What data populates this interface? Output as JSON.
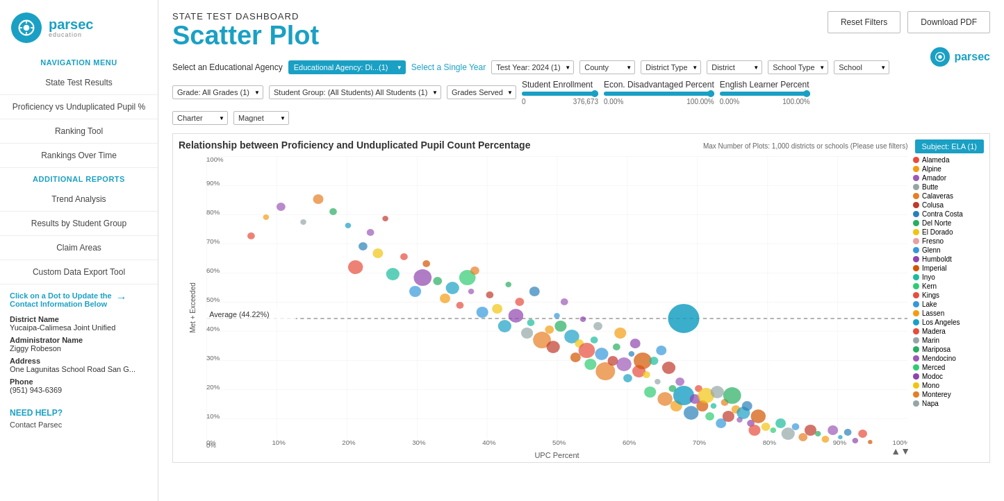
{
  "sidebar": {
    "logo_text": "parsec",
    "logo_sub": "education",
    "nav_title": "NAVIGATION MENU",
    "nav_items": [
      {
        "label": "State Test Results"
      },
      {
        "label": "Proficiency vs Unduplicated Pupil %"
      },
      {
        "label": "Ranking Tool"
      },
      {
        "label": "Rankings Over Time"
      }
    ],
    "additional_title": "ADDITIONAL REPORTS",
    "additional_items": [
      {
        "label": "Trend Analysis"
      },
      {
        "label": "Results by Student Group"
      },
      {
        "label": "Claim Areas"
      },
      {
        "label": "Custom Data Export Tool"
      }
    ],
    "click_hint_line1": "Click on a Dot to Update the",
    "click_hint_line2": "Contact Information Below",
    "district_name_label": "District Name",
    "district_name_value": "Yucaipa-Calimesa Joint Unified",
    "admin_name_label": "Administrator Name",
    "admin_name_value": "Ziggy Robeson",
    "address_label": "Address",
    "address_value": "One Lagunitas School Road San G...",
    "phone_label": "Phone",
    "phone_value": "(951) 943-6369",
    "need_help": "NEED HELP?",
    "contact_link": "Contact Parsec"
  },
  "header": {
    "page_label": "STATE TEST DASHBOARD",
    "page_title": "Scatter Plot",
    "reset_btn": "Reset Filters",
    "download_btn": "Download PDF"
  },
  "filters": {
    "agency_label": "Select an Educational Agency",
    "year_label": "Select a Single Year",
    "agency_value": "Educational Agency: Di...(1)",
    "year_value": "Test Year: 2024  (1)",
    "county_label": "County",
    "district_type_label": "District Type",
    "district_label": "District",
    "school_type_label": "School Type",
    "school_label": "School",
    "grade_label": "Grade: All Grades",
    "grade_count": "(1)",
    "student_group_label": "Student Group: (All Students) All Students",
    "student_group_count": "(1)",
    "grades_served_label": "Grades Served",
    "charter_label": "Charter",
    "magnet_label": "Magnet",
    "slider_enrollment_label": "Student Enrollment",
    "slider_enrollment_min": "0",
    "slider_enrollment_max": "376,673",
    "slider_econ_label": "Econ. Disadvantaged Percent",
    "slider_econ_min": "0.00%",
    "slider_econ_max": "100.00%",
    "slider_el_label": "English Learner Percent",
    "slider_el_min": "0.00%",
    "slider_el_max": "100.00%"
  },
  "chart": {
    "title": "Relationship between Proficiency and Unduplicated Pupil Count Percentage",
    "subtitle": "Max Number of Plots: 1,000 districts or schools (Please use filters)",
    "subject_btn": "Subject: ELA  (1)",
    "average_label": "Average (44.22%)",
    "y_axis_label": "Met + Exceeded",
    "x_axis_label": "UPC Percent",
    "y_ticks": [
      "0%",
      "10%",
      "20%",
      "30%",
      "40%",
      "50%",
      "60%",
      "70%",
      "80%",
      "90%",
      "100%"
    ],
    "x_ticks": [
      "0%",
      "10%",
      "20%",
      "30%",
      "40%",
      "50%",
      "60%",
      "70%",
      "80%",
      "90%",
      "100%"
    ]
  },
  "legend": {
    "counties": [
      {
        "name": "Alameda",
        "color": "#e74c3c"
      },
      {
        "name": "Alpine",
        "color": "#f39c12"
      },
      {
        "name": "Amador",
        "color": "#9b59b6"
      },
      {
        "name": "Butte",
        "color": "#95a5a6"
      },
      {
        "name": "Calaveras",
        "color": "#e67e22"
      },
      {
        "name": "Colusa",
        "color": "#c0392b"
      },
      {
        "name": "Contra Costa",
        "color": "#2980b9"
      },
      {
        "name": "Del Norte",
        "color": "#27ae60"
      },
      {
        "name": "El Dorado",
        "color": "#f1c40f"
      },
      {
        "name": "Fresno",
        "color": "#e8a0a0"
      },
      {
        "name": "Glenn",
        "color": "#3498db"
      },
      {
        "name": "Humboldt",
        "color": "#8e44ad"
      },
      {
        "name": "Imperial",
        "color": "#d35400"
      },
      {
        "name": "Inyo",
        "color": "#1abc9c"
      },
      {
        "name": "Kern",
        "color": "#2ecc71"
      },
      {
        "name": "Kings",
        "color": "#e74c3c"
      },
      {
        "name": "Lake",
        "color": "#3498db"
      },
      {
        "name": "Lassen",
        "color": "#f39c12"
      },
      {
        "name": "Los Angeles",
        "color": "#1aa0c4"
      },
      {
        "name": "Madera",
        "color": "#e74c3c"
      },
      {
        "name": "Marin",
        "color": "#95a5a6"
      },
      {
        "name": "Mariposa",
        "color": "#27ae60"
      },
      {
        "name": "Mendocino",
        "color": "#9b59b6"
      },
      {
        "name": "Merced",
        "color": "#2ecc71"
      },
      {
        "name": "Modoc",
        "color": "#8e44ad"
      },
      {
        "name": "Mono",
        "color": "#f1c40f"
      },
      {
        "name": "Monterey",
        "color": "#e67e22"
      },
      {
        "name": "Napa",
        "color": "#95a5a6"
      }
    ]
  }
}
